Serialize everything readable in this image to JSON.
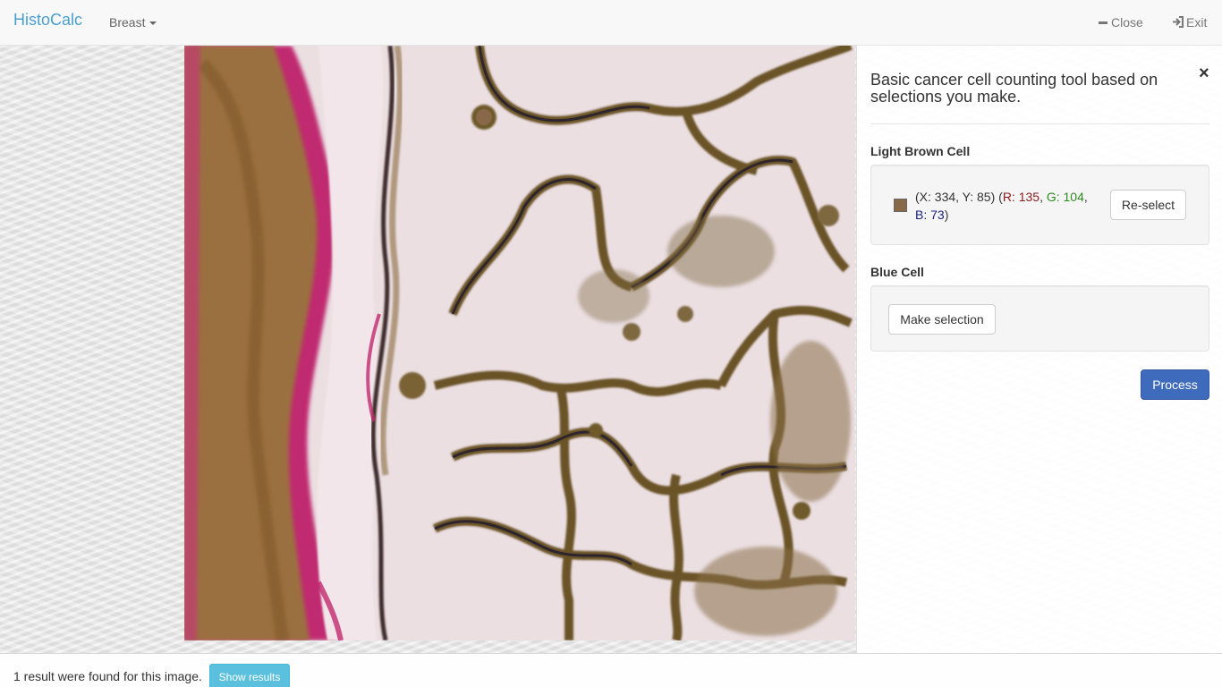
{
  "navbar": {
    "brand": "HistoCalc",
    "tissue_menu": "Breast",
    "close_label": "Close",
    "exit_label": "Exit"
  },
  "panel": {
    "description": "Basic cancer cell counting tool based on selections you make.",
    "close_symbol": "×",
    "light_brown": {
      "title": "Light Brown Cell",
      "swatch_color": "#876849",
      "coords": "(X: 334, Y: 85)",
      "r_label": "R: 135",
      "g_label": "G: 104",
      "b_label": "B: 73",
      "button": "Re-select"
    },
    "blue": {
      "title": "Blue Cell",
      "button": "Make selection"
    },
    "process_button": "Process"
  },
  "footer": {
    "result_text": "1 result were found for this image.",
    "show_results_button": "Show results"
  },
  "colors": {
    "brand": "#4a9fcf",
    "primary": "#3f6bbd",
    "info": "#5bc0de"
  }
}
